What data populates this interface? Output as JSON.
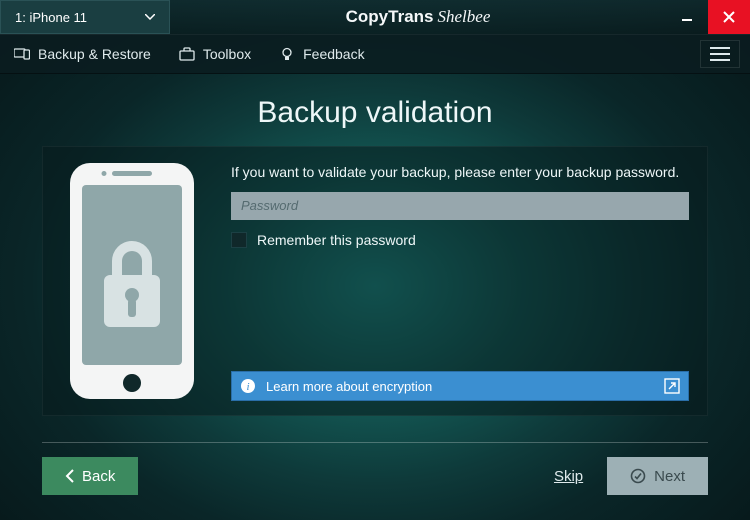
{
  "titlebar": {
    "device_label": "1: iPhone 11",
    "brand_a": "CopyTrans",
    "brand_b": "Shelbee"
  },
  "tabs": {
    "backup_restore": "Backup & Restore",
    "toolbox": "Toolbox",
    "feedback": "Feedback"
  },
  "main": {
    "heading": "Backup validation",
    "prompt": "If you want to validate your backup, please enter your backup password.",
    "password_placeholder": "Password",
    "remember_label": "Remember this password",
    "learn_more": "Learn more about encryption"
  },
  "footer": {
    "back": "Back",
    "skip": "Skip",
    "next": "Next"
  }
}
